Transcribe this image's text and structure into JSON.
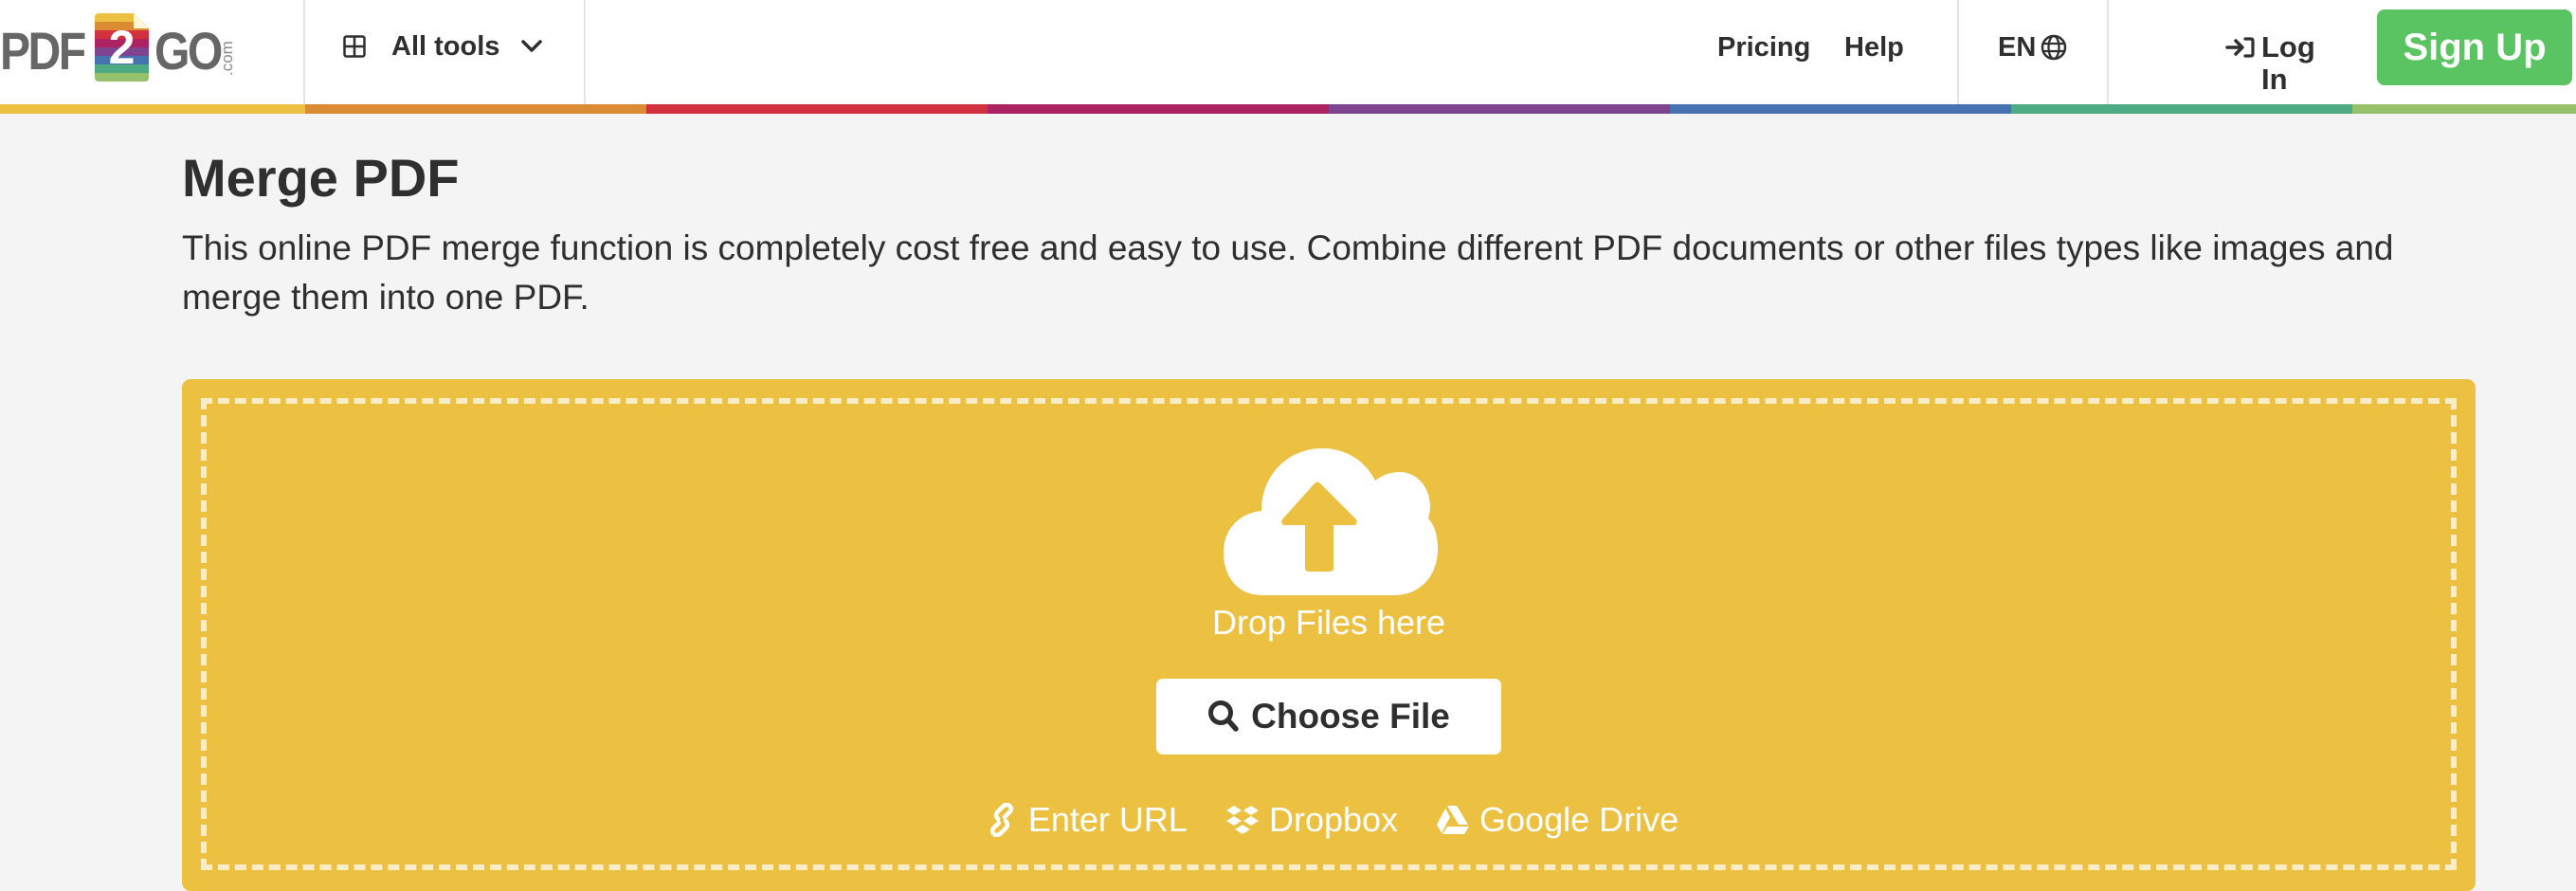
{
  "header": {
    "logo": {
      "left": "PDF",
      "middle": "2",
      "right": "GO",
      "suffix": ".com",
      "file_bands": [
        "#ecc141",
        "#db8c32",
        "#d1303d",
        "#ad2362",
        "#7e448f",
        "#4672b0",
        "#4eaa83",
        "#97c06a"
      ]
    },
    "all_tools_label": "All tools",
    "nav": {
      "pricing": "Pricing",
      "help": "Help"
    },
    "language": "EN",
    "login_label": "Log In",
    "signup_label": "Sign Up"
  },
  "stripe_colors": [
    "#ecc141",
    "#db8c32",
    "#d1303d",
    "#ad2362",
    "#7e448f",
    "#4672b0",
    "#4eaa83",
    "#97c06a"
  ],
  "main": {
    "title": "Merge PDF",
    "description": "This online PDF merge function is completely cost free and easy to use. Combine different PDF documents or other files types like images and merge them into one PDF.",
    "dropzone": {
      "drop_label": "Drop Files here",
      "choose_label": "Choose File",
      "links": [
        {
          "icon": "link-icon",
          "label": "Enter URL"
        },
        {
          "icon": "dropbox-icon",
          "label": "Dropbox"
        },
        {
          "icon": "google-drive-icon",
          "label": "Google Drive"
        }
      ]
    }
  },
  "colors": {
    "accent": "#ecc141",
    "signup": "#5bc462",
    "text": "#2f2f2f",
    "background": "#f4f4f4"
  }
}
